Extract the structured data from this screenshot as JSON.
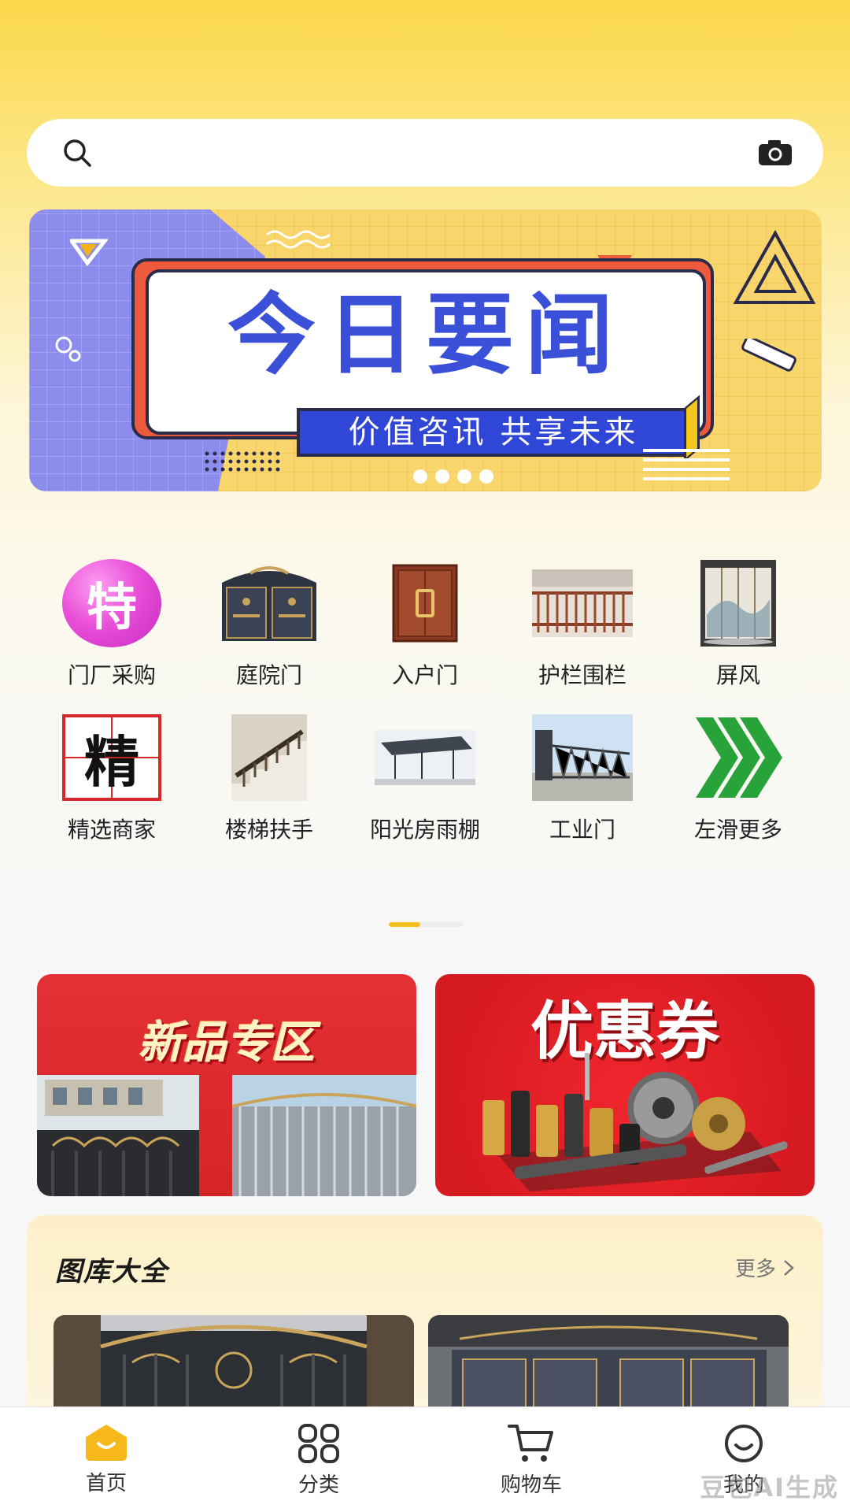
{
  "search": {
    "value": "",
    "placeholder": "",
    "search_icon": "search-icon",
    "camera_icon": "camera-icon"
  },
  "banner": {
    "title": "今日要闻",
    "subtitle": "价值咨讯 共享未来",
    "slide_count": 4,
    "active_slide": 1
  },
  "categories": [
    {
      "label": "门厂采购",
      "icon": "特"
    },
    {
      "label": "庭院门"
    },
    {
      "label": "入户门"
    },
    {
      "label": "护栏围栏"
    },
    {
      "label": "屏风"
    },
    {
      "label": "精选商家",
      "icon": "精"
    },
    {
      "label": "楼梯扶手"
    },
    {
      "label": "阳光房雨棚"
    },
    {
      "label": "工业门"
    },
    {
      "label": "左滑更多",
      "icon": "chevrons-right-icon"
    }
  ],
  "promos": {
    "new_products": "新品专区",
    "coupon": "优惠券"
  },
  "gallery": {
    "title": "图库大全",
    "more": "更多"
  },
  "tabbar": [
    {
      "label": "首页",
      "icon": "home-icon",
      "active": true
    },
    {
      "label": "分类",
      "icon": "grid-icon",
      "active": false
    },
    {
      "label": "购物车",
      "icon": "cart-icon",
      "active": false
    },
    {
      "label": "我的",
      "icon": "smile-icon",
      "active": false
    }
  ],
  "colors": {
    "accent": "#f4c020",
    "banner_title": "#3b50d8",
    "promo_red": "#e02a2f"
  },
  "watermark": "豆包AI生成"
}
